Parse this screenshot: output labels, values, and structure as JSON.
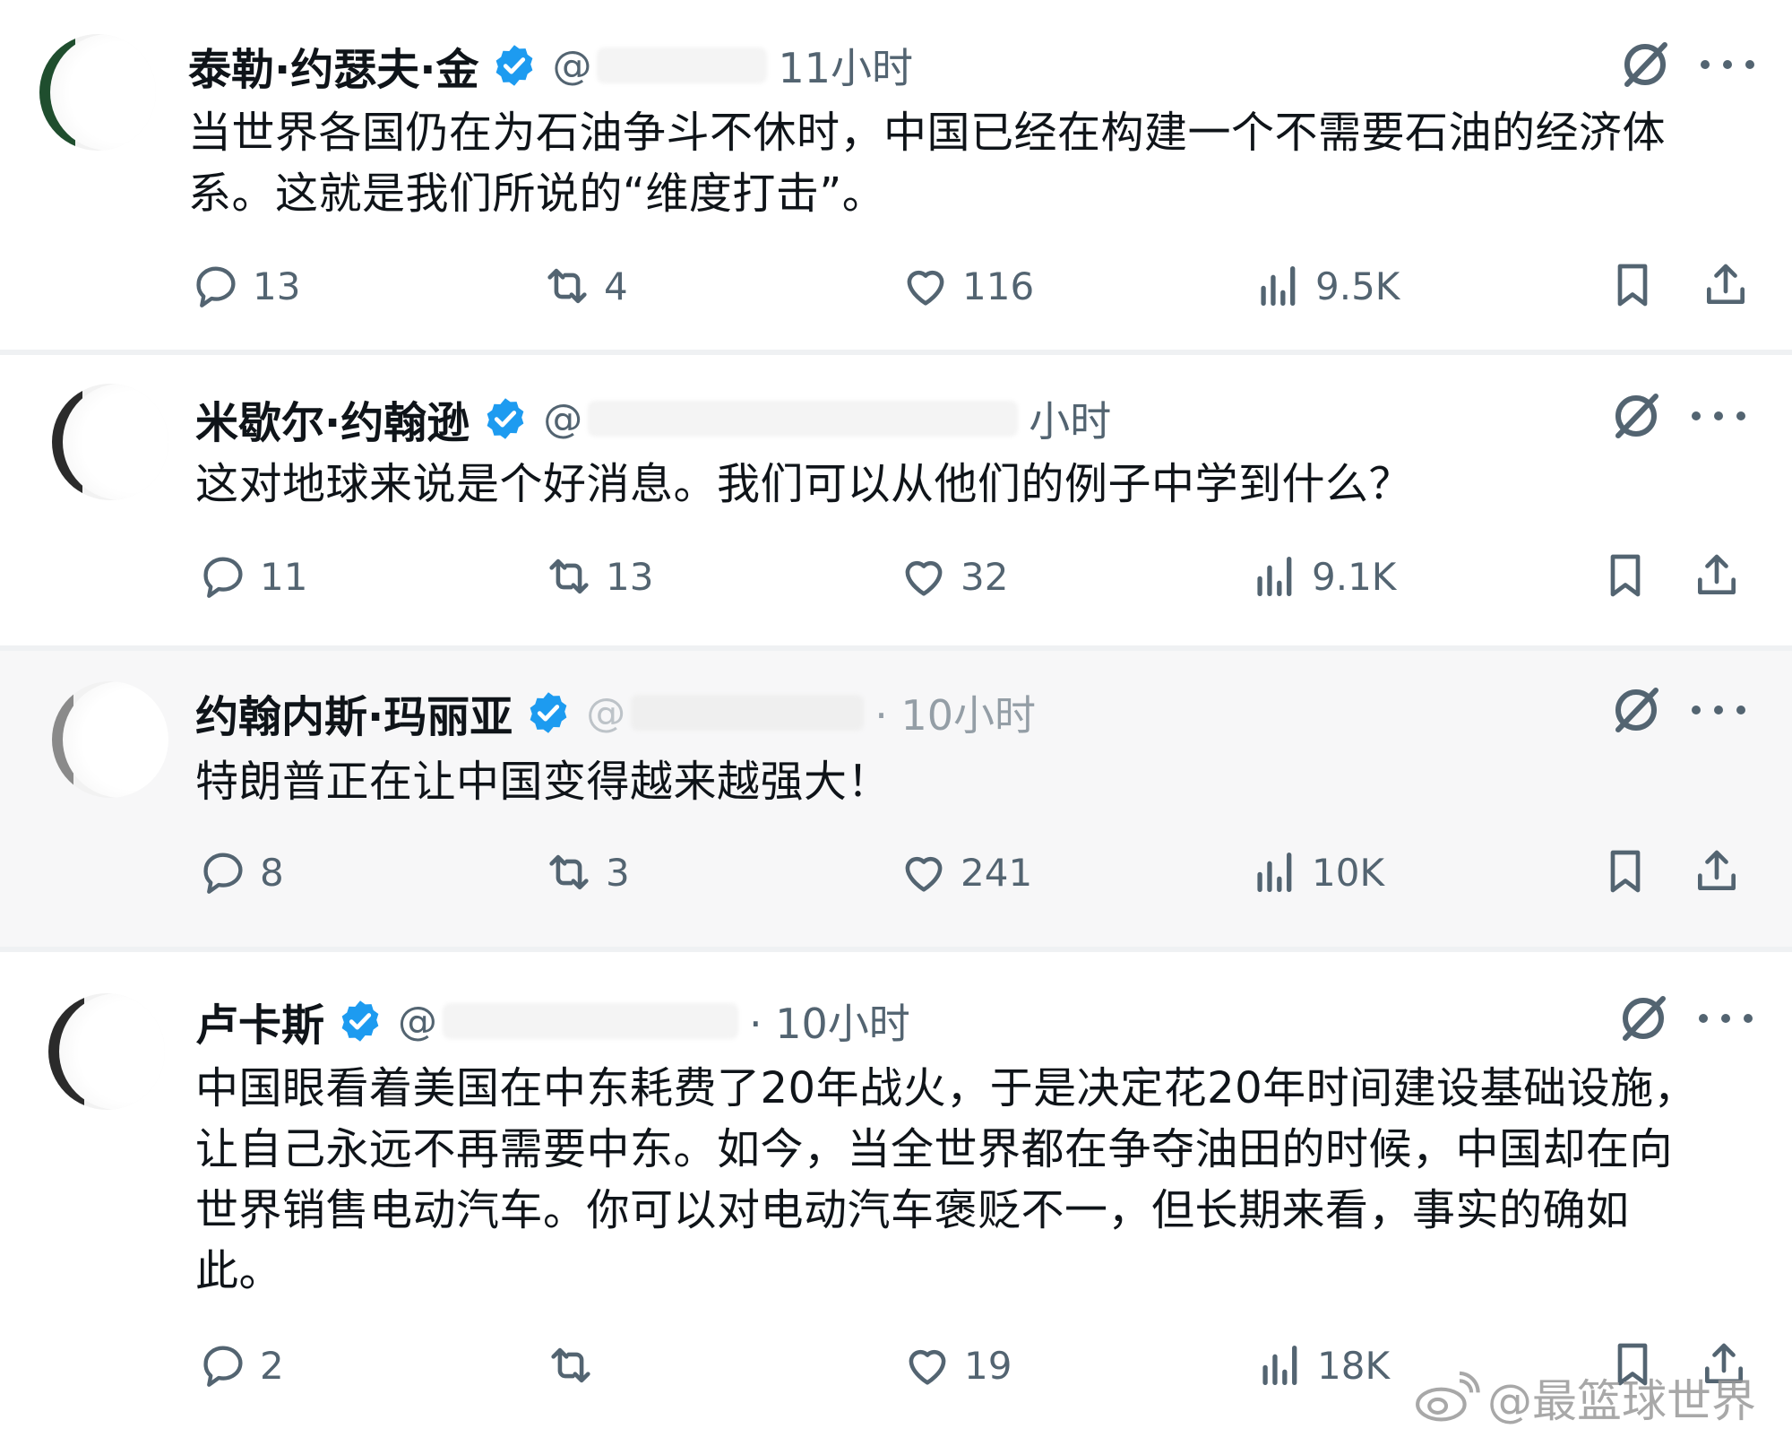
{
  "posts": [
    {
      "name": "泰勒·约瑟夫·金",
      "handle": "@",
      "time": "11小时",
      "text": "当世界各国仍在为石油争斗不休时，中国已经在构建一个不需要石油的经济体\n系。这就是我们所说的“维度打击”。",
      "replies": "13",
      "reposts": "4",
      "likes": "116",
      "views": "9.5K"
    },
    {
      "name": "米歇尔·约翰逊",
      "handle": "@",
      "time": "小时",
      "text": "这对地球来说是个好消息。我们可以从他们的例子中学到什么？",
      "replies": "11",
      "reposts": "13",
      "likes": "32",
      "views": "9.1K"
    },
    {
      "name": "约翰内斯·玛丽亚",
      "handle": "@",
      "time": "· 10小时",
      "text": "特朗普正在让中国变得越来越强大！",
      "replies": "8",
      "reposts": "3",
      "likes": "241",
      "views": "10K"
    },
    {
      "name": "卢卡斯",
      "handle": "@",
      "time": "· 10小时",
      "text": "中国眼看着美国在中东耗费了20年战火，于是决定花20年时间建设基础设施，\n让自己永远不再需要中东。如今，当全世界都在争夺油田的时候，中国却在向\n世界销售电动汽车。你可以对电动汽车褒贬不一，但长期来看，事实的确如\n此。",
      "replies": "2",
      "reposts": "",
      "likes": "19",
      "views": "18K"
    }
  ],
  "watermark": "@最篮球世界",
  "colors": {
    "verified": "#1d9bf0",
    "secondary_text": "#536471",
    "primary_text": "#0f1419"
  }
}
